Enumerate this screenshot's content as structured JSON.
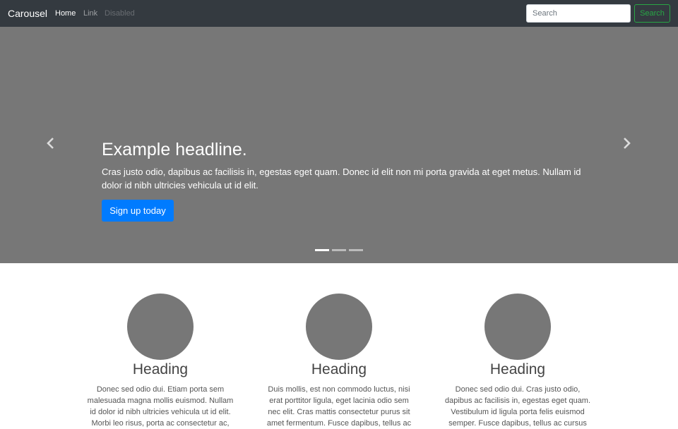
{
  "navbar": {
    "brand": "Carousel",
    "links": [
      {
        "label": "Home",
        "state": "active"
      },
      {
        "label": "Link",
        "state": "default"
      },
      {
        "label": "Disabled",
        "state": "disabled"
      }
    ],
    "search": {
      "placeholder": "Search",
      "value": "",
      "button_label": "Search"
    }
  },
  "carousel": {
    "controls": {
      "prev_icon": "chevron-left-icon",
      "next_icon": "chevron-right-icon"
    },
    "headline": "Example headline.",
    "lead": "Cras justo odio, dapibus ac facilisis in, egestas eget quam. Donec id elit non mi porta gravida at eget metus. Nullam id dolor id nibh ultricies vehicula ut id elit.",
    "button_label": "Sign up today",
    "slide_count": 3,
    "active_slide": 1
  },
  "columns": [
    {
      "heading": "Heading",
      "text": "Donec sed odio dui. Etiam porta sem malesuada magna mollis euismod. Nullam id dolor id nibh ultricies vehicula ut id elit. Morbi leo risus, porta ac consectetur ac,"
    },
    {
      "heading": "Heading",
      "text": "Duis mollis, est non commodo luctus, nisi erat porttitor ligula, eget lacinia odio sem nec elit. Cras mattis consectetur purus sit amet fermentum. Fusce dapibus, tellus ac"
    },
    {
      "heading": "Heading",
      "text": "Donec sed odio dui. Cras justo odio, dapibus ac facilisis in, egestas eget quam. Vestibulum id ligula porta felis euismod semper. Fusce dapibus, tellus ac cursus"
    }
  ],
  "colors": {
    "navbar_bg": "#343a40",
    "carousel_bg": "#777777",
    "primary": "#007bff",
    "success": "#28a745",
    "placeholder_gray": "#777777"
  }
}
